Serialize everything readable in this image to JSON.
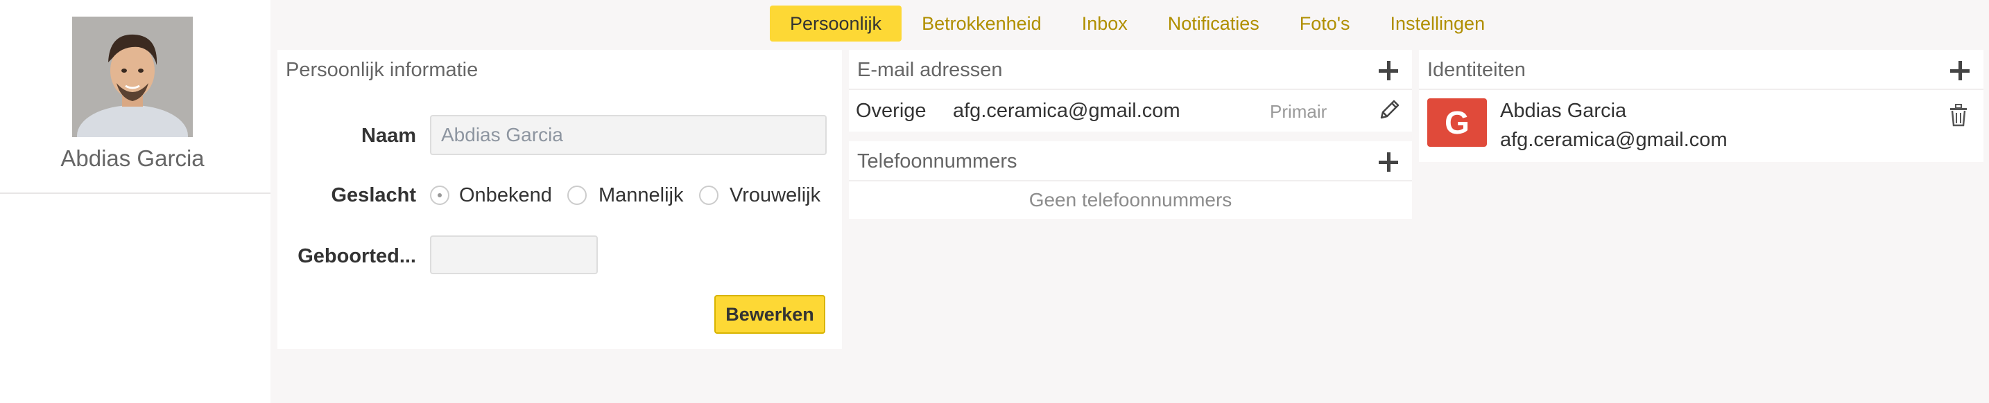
{
  "profile": {
    "name": "Abdias Garcia"
  },
  "tabs": [
    {
      "label": "Persoonlijk",
      "active": true
    },
    {
      "label": "Betrokkenheid",
      "active": false
    },
    {
      "label": "Inbox",
      "active": false
    },
    {
      "label": "Notificaties",
      "active": false
    },
    {
      "label": "Foto's",
      "active": false
    },
    {
      "label": "Instellingen",
      "active": false
    }
  ],
  "personal": {
    "title": "Persoonlijk informatie",
    "name_label": "Naam",
    "name_value": "Abdias Garcia",
    "gender_label": "Geslacht",
    "gender_options": [
      "Onbekend",
      "Mannelijk",
      "Vrouwelijk"
    ],
    "gender_selected": "Onbekend",
    "birth_label": "Geboorted...",
    "birth_value": "",
    "edit_label": "Bewerken"
  },
  "email": {
    "title": "E-mail adressen",
    "rows": [
      {
        "type": "Overige",
        "address": "afg.ceramica@gmail.com",
        "status": "Primair"
      }
    ]
  },
  "phone": {
    "title": "Telefoonnummers",
    "empty_text": "Geen telefoonnummers"
  },
  "identities": {
    "title": "Identiteiten",
    "items": [
      {
        "provider_letter": "G",
        "name": "Abdias Garcia",
        "email": "afg.ceramica@gmail.com"
      }
    ]
  },
  "colors": {
    "accent": "#fdd835",
    "tab_text": "#b08f00",
    "google_red": "#e04a3a",
    "background": "#f8f6f6"
  }
}
